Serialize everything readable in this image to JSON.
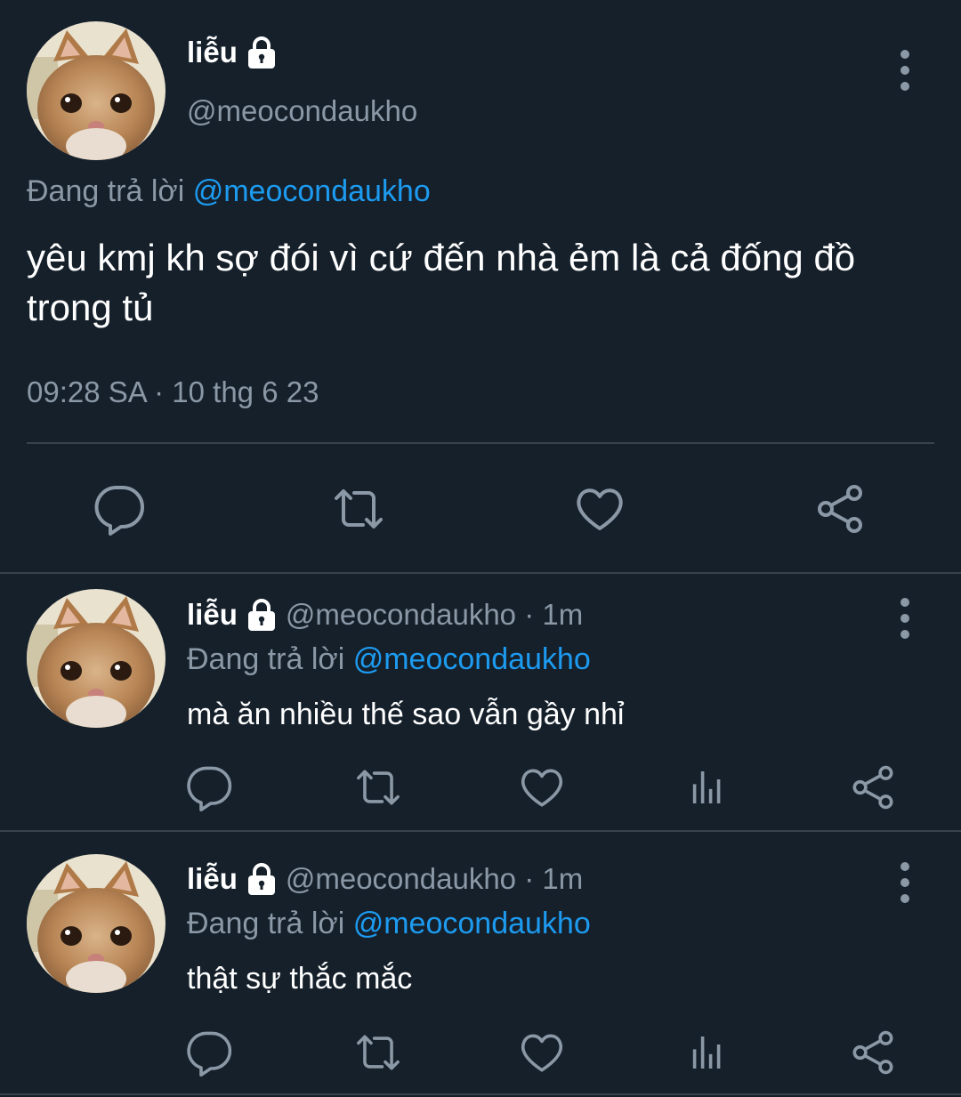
{
  "main_tweet": {
    "display_name": "liễu",
    "handle": "@meocondaukho",
    "reply_prefix": "Đang trả lời",
    "reply_to": "@meocondaukho",
    "text": "yêu kmj kh sợ đói vì cứ đến nhà ẻm là cả đống đồ trong tủ",
    "timestamp": "09:28 SA · 10 thg 6 23",
    "actions": [
      "reply-icon",
      "retweet-icon",
      "like-icon",
      "share-icon"
    ]
  },
  "replies": [
    {
      "display_name": "liễu",
      "handle_time": "@meocondaukho · 1m",
      "reply_prefix": "Đang trả lời",
      "reply_to": "@meocondaukho",
      "text": "mà ăn nhiều thế sao vẫn gầy nhỉ",
      "actions": [
        "reply-icon",
        "retweet-icon",
        "like-icon",
        "analytics-icon",
        "share-icon"
      ]
    },
    {
      "display_name": "liễu",
      "handle_time": "@meocondaukho · 1m",
      "reply_prefix": "Đang trả lời",
      "reply_to": "@meocondaukho",
      "text": "thật sự thắc mắc",
      "actions": [
        "reply-icon",
        "retweet-icon",
        "like-icon",
        "analytics-icon",
        "share-icon"
      ]
    }
  ],
  "colors": {
    "background": "#15202b",
    "text": "#ffffff",
    "secondary": "#8b98a5",
    "link": "#1d9bf0",
    "divider": "#38444d"
  }
}
